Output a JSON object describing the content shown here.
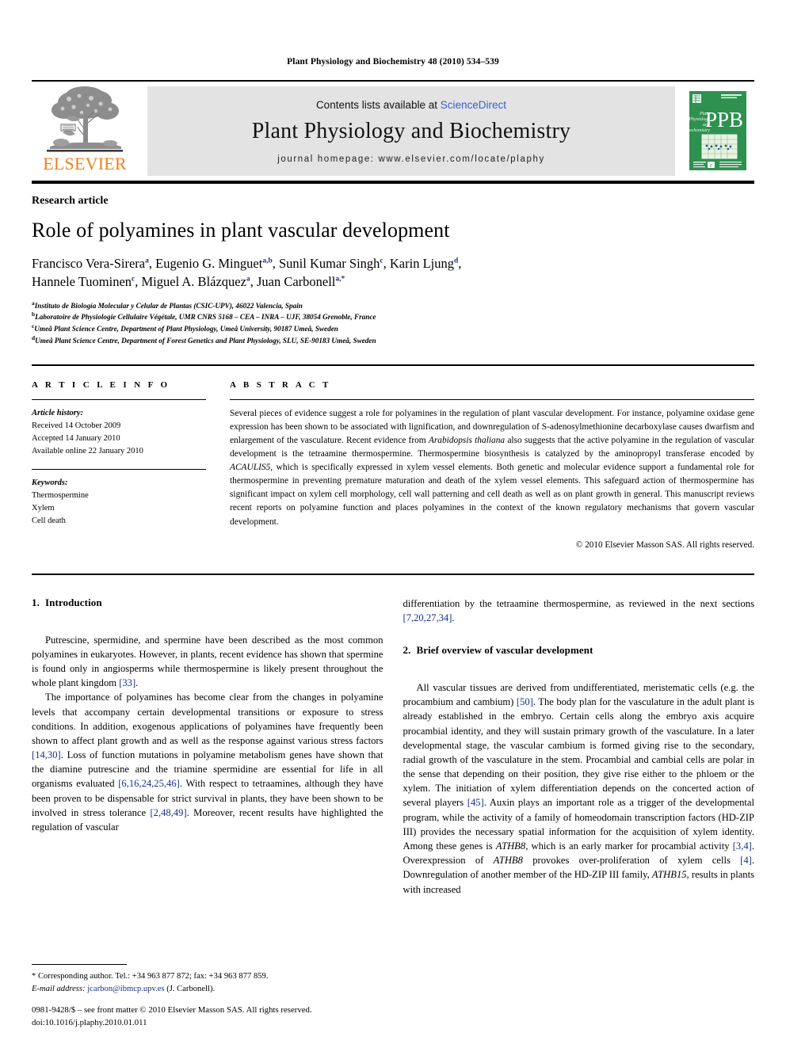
{
  "running_head": "Plant Physiology and Biochemistry 48 (2010) 534–539",
  "masthead": {
    "publisher_name": "ELSEVIER",
    "contents_prefix": "Contents lists available at ",
    "sciencedirect": "ScienceDirect",
    "journal_title": "Plant Physiology and Biochemistry",
    "homepage": "journal homepage: www.elsevier.com/locate/plaphy",
    "cover": {
      "acronym": "PPB",
      "title_line1": "Plant",
      "title_line2": "Physiology",
      "title_line3": "and",
      "title_line4": "Biochemistry",
      "background_color": "#2e9150"
    },
    "link_color": "#3a5fcd",
    "elsevier_orange": "#F07F1A"
  },
  "article": {
    "type": "Research article",
    "title": "Role of polyamines in plant vascular development",
    "authors": [
      {
        "name": "Francisco Vera-Sirera",
        "marks": "a",
        "sep": ", "
      },
      {
        "name": "Eugenio G. Minguet",
        "marks": "a,b",
        "sep": ", "
      },
      {
        "name": "Sunil Kumar Singh",
        "marks": "c",
        "sep": ", "
      },
      {
        "name": "Karin Ljung",
        "marks": "d",
        "sep": ","
      },
      {
        "name": "Hannele Tuominen",
        "marks": "c",
        "sep": ", "
      },
      {
        "name": "Miguel A. Blázquez",
        "marks": "a",
        "sep": ", "
      },
      {
        "name": "Juan Carbonell",
        "marks": "a,*",
        "sep": ""
      }
    ],
    "affiliations": [
      {
        "mark": "a",
        "text": "Instituto de Biología Molecular y Celular de Plantas (CSIC-UPV), 46022 Valencia, Spain"
      },
      {
        "mark": "b",
        "text": "Laboratoire de Physiologie Cellulaire Végétale, UMR CNRS 5168 – CEA – INRA – UJF, 38054 Grenoble, France"
      },
      {
        "mark": "c",
        "text": "Umeå Plant Science Centre, Department of Plant Physiology, Umeå University, 90187 Umeå, Sweden"
      },
      {
        "mark": "d",
        "text": "Umeå Plant Science Centre, Department of Forest Genetics and Plant Physiology, SLU, SE-90183 Umeå, Sweden"
      }
    ]
  },
  "article_info": {
    "heading": "A R T I C L E  I N F O",
    "history_label": "Article history:",
    "history": [
      "Received 14 October 2009",
      "Accepted 14 January 2010",
      "Available online 22 January 2010"
    ],
    "keywords_label": "Keywords:",
    "keywords": [
      "Thermospermine",
      "Xylem",
      "Cell death"
    ]
  },
  "abstract": {
    "heading": "A B S T R A C T",
    "part1": "Several pieces of evidence suggest a role for polyamines in the regulation of plant vascular development. For instance, polyamine oxidase gene expression has been shown to be associated with lignification, and downregulation of S-adenosylmethionine decarboxylase causes dwarfism and enlargement of the vasculature. Recent evidence from ",
    "italic1": "Arabidopsis thaliana",
    "part2": " also suggests that the active polyamine in the regulation of vascular development is the tetraamine thermospermine. Thermospermine biosynthesis is catalyzed by the aminopropyl transferase encoded by ",
    "italic2": "ACAULIS5",
    "part3": ", which is specifically expressed in xylem vessel elements. Both genetic and molecular evidence support a fundamental role for thermospermine in preventing premature maturation and death of the xylem vessel elements. This safeguard action of thermospermine has significant impact on xylem cell morphology, cell wall patterning and cell death as well as on plant growth in general. This manuscript reviews recent reports on polyamine function and places polyamines in the context of the known regulatory mechanisms that govern vascular development.",
    "copyright": "© 2010 Elsevier Masson SAS. All rights reserved."
  },
  "sections": {
    "intro": {
      "number": "1.",
      "title": "Introduction",
      "p1_a": "Putrescine, spermidine, and spermine have been described as the most common polyamines in eukaryotes. However, in plants, recent evidence has shown that spermine is found only in angiosperms while thermospermine is likely present throughout the whole plant kingdom ",
      "p1_ref1": "[33]",
      "p1_b": ".",
      "p2_a": "The importance of polyamines has become clear from the changes in polyamine levels that accompany certain developmental transitions or exposure to stress conditions. In addition, exogenous applications of polyamines have frequently been shown to affect plant growth and as well as the response against various stress factors ",
      "p2_ref1": "[14,30]",
      "p2_b": ". Loss of function mutations in polyamine metabolism genes have shown that the diamine putrescine and the triamine spermidine are essential for life in all organisms evaluated ",
      "p2_ref2": "[6,16,24,25,46]",
      "p2_c": ". With respect to tetraamines, although they have been proven to be dispensable for strict survival in plants, they have been shown to be involved in stress tolerance ",
      "p2_ref3": "[2,48,49]",
      "p2_d": ". Moreover, recent results have highlighted the regulation of vascular differentiation by the tetraamine thermospermine, as reviewed in the next sections ",
      "p2_ref4": "[7,20,27,34]",
      "p2_e": "."
    },
    "overview": {
      "number": "2.",
      "title": "Brief overview of vascular development",
      "p1_a": "All vascular tissues are derived from undifferentiated, meristematic cells (e.g. the procambium and cambium) ",
      "p1_ref1": "[50]",
      "p1_b": ". The body plan for the vasculature in the adult plant is already established in the embryo. Certain cells along the embryo axis acquire procambial identity, and they will sustain primary growth of the vasculature. In a later developmental stage, the vascular cambium is formed giving rise to the secondary, radial growth of the vasculature in the stem. Procambial and cambial cells are polar in the sense that depending on their position, they give rise either to the phloem or the xylem. The initiation of xylem differentiation depends on the concerted action of several players ",
      "p1_ref2": "[45]",
      "p1_c": ". Auxin plays an important role as a trigger of the developmental program, while the activity of a family of homeodomain transcription factors (HD-ZIP III) provides the necessary spatial information for the acquisition of xylem identity. Among these genes is ",
      "p1_gene1": "ATHB8",
      "p1_d": ", which is an early marker for procambial activity ",
      "p1_ref3": "[3,4]",
      "p1_e": ". Overexpression of ",
      "p1_gene2": "ATHB8",
      "p1_f": " provokes over-proliferation of xylem cells ",
      "p1_ref4": "[4]",
      "p1_g": ". Downregulation of another member of the HD-ZIP III family, ",
      "p1_gene3": "ATHB15",
      "p1_h": ", results in plants with increased"
    }
  },
  "footnotes": {
    "corresponding": "* Corresponding author. Tel.: +34 963 877 872; fax: +34 963 877 859.",
    "email_label": "E-mail address:",
    "email": "jcarbon@ibmcp.upv.es",
    "email_suffix": "(J. Carbonell)."
  },
  "imprint": {
    "line1": "0981-9428/$ – see front matter © 2010 Elsevier Masson SAS. All rights reserved.",
    "line2": "doi:10.1016/j.plaphy.2010.01.011"
  }
}
